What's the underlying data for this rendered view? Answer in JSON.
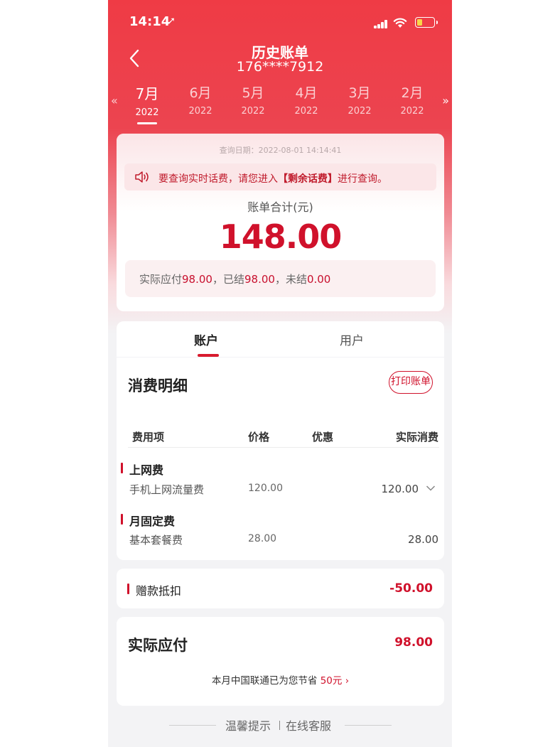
{
  "status_bar": {
    "time": "14:14",
    "location_glyph": "➚"
  },
  "header": {
    "title": "历史账单",
    "phone": "176****7912",
    "prev_glyph": "«",
    "next_glyph": "»"
  },
  "months": [
    {
      "month": "7月",
      "year": "2022",
      "active": true
    },
    {
      "month": "6月",
      "year": "2022",
      "active": false
    },
    {
      "month": "5月",
      "year": "2022",
      "active": false
    },
    {
      "month": "4月",
      "year": "2022",
      "active": false
    },
    {
      "month": "3月",
      "year": "2022",
      "active": false
    },
    {
      "month": "2月",
      "year": "2022",
      "active": false
    }
  ],
  "bill": {
    "query_date": "查询日期：2022-08-01 14:14:41",
    "notice_pre": "要查询实时话费，请您进入",
    "notice_link": "【剩余话费】",
    "notice_post": "进行查询。",
    "total_label": "账单合计(元)",
    "total_amount": "148.00",
    "paid_pre": "实际应付",
    "paid_value": "98.00",
    "settled_pre": "，已结",
    "settled_value": "98.00",
    "unsettled_pre": "，未结",
    "unsettled_value": "0.00"
  },
  "tabs": {
    "account": "账户",
    "user": "用户"
  },
  "detail": {
    "title": "消费明细",
    "print_button": "打印账单",
    "columns": {
      "item": "费用项",
      "price": "价格",
      "discount": "优惠",
      "actual": "实际消费"
    },
    "groups": [
      {
        "name": "上网费",
        "item": "手机上网流量费",
        "price": "120.00",
        "actual": "120.00"
      },
      {
        "name": "月固定费",
        "item": "基本套餐费",
        "price": "28.00",
        "actual": "28.00"
      }
    ]
  },
  "gift": {
    "label": "赠款抵扣",
    "amount": "-50.00"
  },
  "actual_pay": {
    "title": "实际应付",
    "amount": "98.00",
    "save_pre": "本月中国联通已为您节省 ",
    "save_value": "50元",
    "save_arrow": "›"
  },
  "footer": {
    "tips": "温馨提示",
    "service": "在线客服"
  },
  "colors": {
    "brand_red": "#d0112b",
    "header_red": "#ef3b45"
  }
}
